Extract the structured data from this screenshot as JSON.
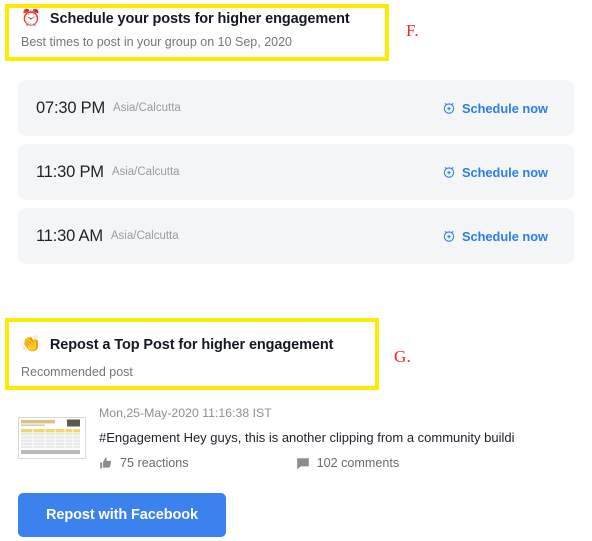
{
  "colors": {
    "annotation_highlight": "#ffea00",
    "annotation_label": "#ff2222",
    "accent_link": "#2b7de9",
    "button_primary": "#3b82ef",
    "row_background": "#f4f5f7",
    "muted_text": "#767676"
  },
  "annotations": [
    {
      "id": "F",
      "label": "F."
    },
    {
      "id": "G",
      "label": "G."
    }
  ],
  "schedule_section": {
    "emoji": "⏰",
    "emoji_name": "alarm-clock-emoji",
    "title": "Schedule your posts for higher engagement",
    "subtitle": "Best times to post in your group on 10 Sep, 2020",
    "action_label": "Schedule now",
    "action_icon": "alarm-plus-icon",
    "slots": [
      {
        "time": "07:30 PM",
        "timezone": "Asia/Calcutta",
        "action": "Schedule now"
      },
      {
        "time": "11:30 PM",
        "timezone": "Asia/Calcutta",
        "action": "Schedule now"
      },
      {
        "time": "11:30 AM",
        "timezone": "Asia/Calcutta",
        "action": "Schedule now"
      }
    ]
  },
  "repost_section": {
    "emoji": "👏",
    "emoji_name": "clapping-hands-emoji",
    "title": "Repost a Top Post for higher engagement",
    "subtitle": "Recommended post",
    "post": {
      "thumbnail_name": "spreadsheet-thumbnail",
      "timestamp": "Mon,25-May-2020 11:16:38 IST",
      "text": "#Engagement Hey guys, this is another clipping from a community buildi",
      "reactions": "75 reactions",
      "reactions_icon": "thumbs-up-icon",
      "comments": "102 comments",
      "comments_icon": "comment-bubble-icon"
    },
    "button_label": "Repost with Facebook"
  }
}
